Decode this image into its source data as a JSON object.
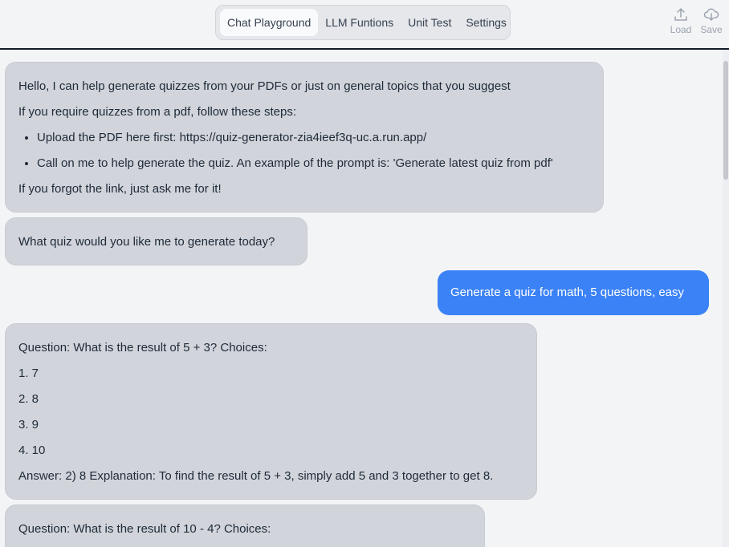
{
  "header": {
    "tabs": [
      {
        "label": "Chat Playground",
        "active": true
      },
      {
        "label": "LLM Funtions",
        "active": false
      },
      {
        "label": "Unit Test",
        "active": false
      },
      {
        "label": "Settings",
        "active": false
      }
    ],
    "load_label": "Load",
    "save_label": "Save"
  },
  "messages": {
    "m1": {
      "line1": "Hello, I can help generate quizzes from your PDFs or just on general topics that you suggest",
      "line2": "If you require quizzes from a pdf, follow these steps:",
      "bullet1": "Upload the PDF here first: https://quiz-generator-zia4ieef3q-uc.a.run.app/",
      "bullet2": "Call on me to help generate the quiz. An example of the prompt is: 'Generate latest quiz from pdf'",
      "line3": "If you forgot the link, just ask me for it!"
    },
    "m2": "What quiz would you like me to generate today?",
    "m3": "Generate a quiz for math, 5 questions, easy",
    "m4": {
      "question": "Question: What is the result of 5 + 3? Choices:",
      "choices": [
        "1. 7",
        "2. 8",
        "3. 9",
        "4. 10"
      ],
      "answer": "Answer: 2) 8 Explanation: To find the result of 5 + 3, simply add 5 and 3 together to get 8."
    },
    "m5": {
      "question": "Question: What is the result of 10 - 4? Choices:"
    }
  },
  "colors": {
    "user_bubble": "#3b82f6",
    "bot_bubble": "#d1d5db",
    "background": "#f3f4f6"
  }
}
